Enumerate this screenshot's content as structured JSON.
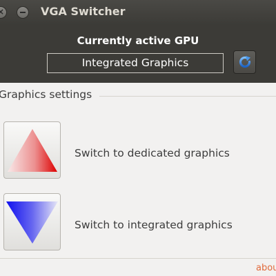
{
  "window": {
    "title": "VGA Switcher"
  },
  "header": {
    "label": "Currently active GPU",
    "active_gpu": "Integrated Graphics"
  },
  "settings": {
    "section_label": "Graphics settings",
    "dedicated_label": "Switch to dedicated graphics",
    "integrated_label": "Switch to integrated graphics"
  },
  "footer": {
    "about_link": "about"
  },
  "icons": {
    "refresh": "refresh-icon",
    "dedicated": "red-triangle-up-icon",
    "integrated": "blue-triangle-down-icon"
  },
  "colors": {
    "header_bg": "#3c3b37",
    "dedicated_accent": "#e00000",
    "integrated_accent": "#1a1ae6",
    "refresh_accent": "#2f7fd6",
    "link": "#e1693b"
  }
}
